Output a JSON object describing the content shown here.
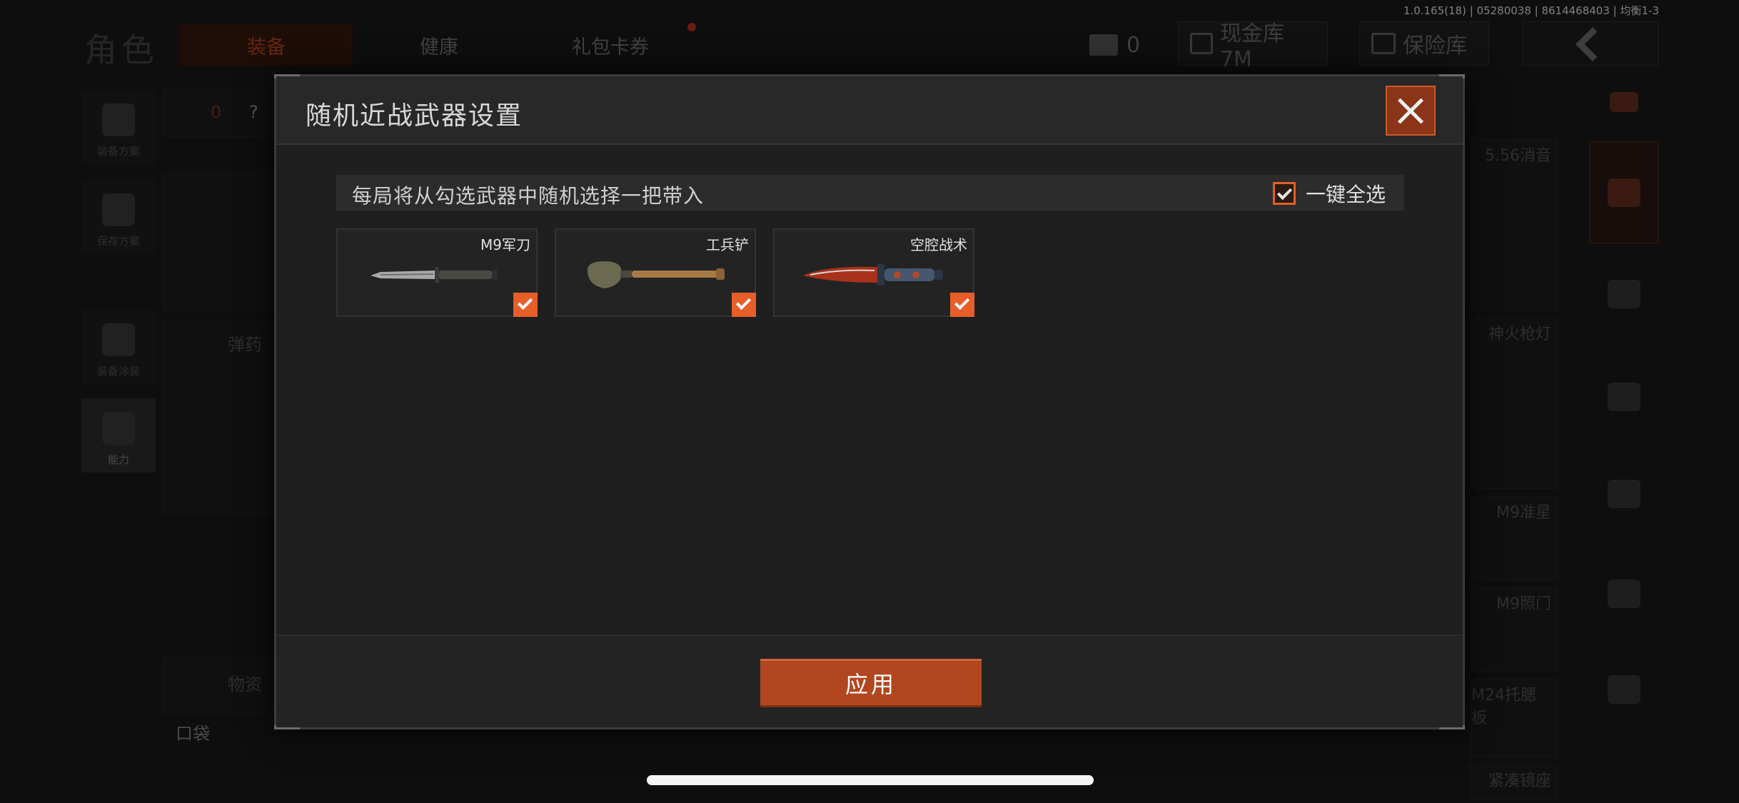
{
  "version": "1.0.165(18) | 05280038 | 8614468403 | 均衡1-3",
  "background": {
    "page_title": "角色",
    "tabs": [
      {
        "label": "装备"
      },
      {
        "label": "健康"
      },
      {
        "label": "礼包卡券"
      }
    ],
    "currency": {
      "ticket_count": "0"
    },
    "cash_vault_label": "现金库 7M",
    "insurance_vault_label": "保险库",
    "sidebar": [
      {
        "label": "装备方案"
      },
      {
        "label": "保存方案"
      },
      {
        "label": "装备涂装"
      },
      {
        "label": "能力"
      }
    ],
    "backpack_count": "0",
    "question_mark": "?",
    "ammo_section": "弹药",
    "supplies_section": "物资",
    "pocket_label": "口袋",
    "right_items": [
      {
        "label": "5.56消音"
      },
      {
        "label": "神火枪灯"
      },
      {
        "label": "M9准星"
      },
      {
        "label": "M9照门"
      },
      {
        "label": "M24托腮板"
      },
      {
        "label": "紧凑镜座"
      }
    ]
  },
  "modal": {
    "title": "随机近战武器设置",
    "info_text": "每局将从勾选武器中随机选择一把带入",
    "select_all_label": "一键全选",
    "select_all_checked": true,
    "weapons": [
      {
        "name": "M9军刀",
        "checked": true
      },
      {
        "name": "工兵铲",
        "checked": true
      },
      {
        "name": "空腔战术",
        "checked": true
      }
    ],
    "apply_label": "应用"
  },
  "colors": {
    "accent": "#e85e28",
    "button": "#b2471f",
    "modal_bg": "#1f1f1f"
  }
}
